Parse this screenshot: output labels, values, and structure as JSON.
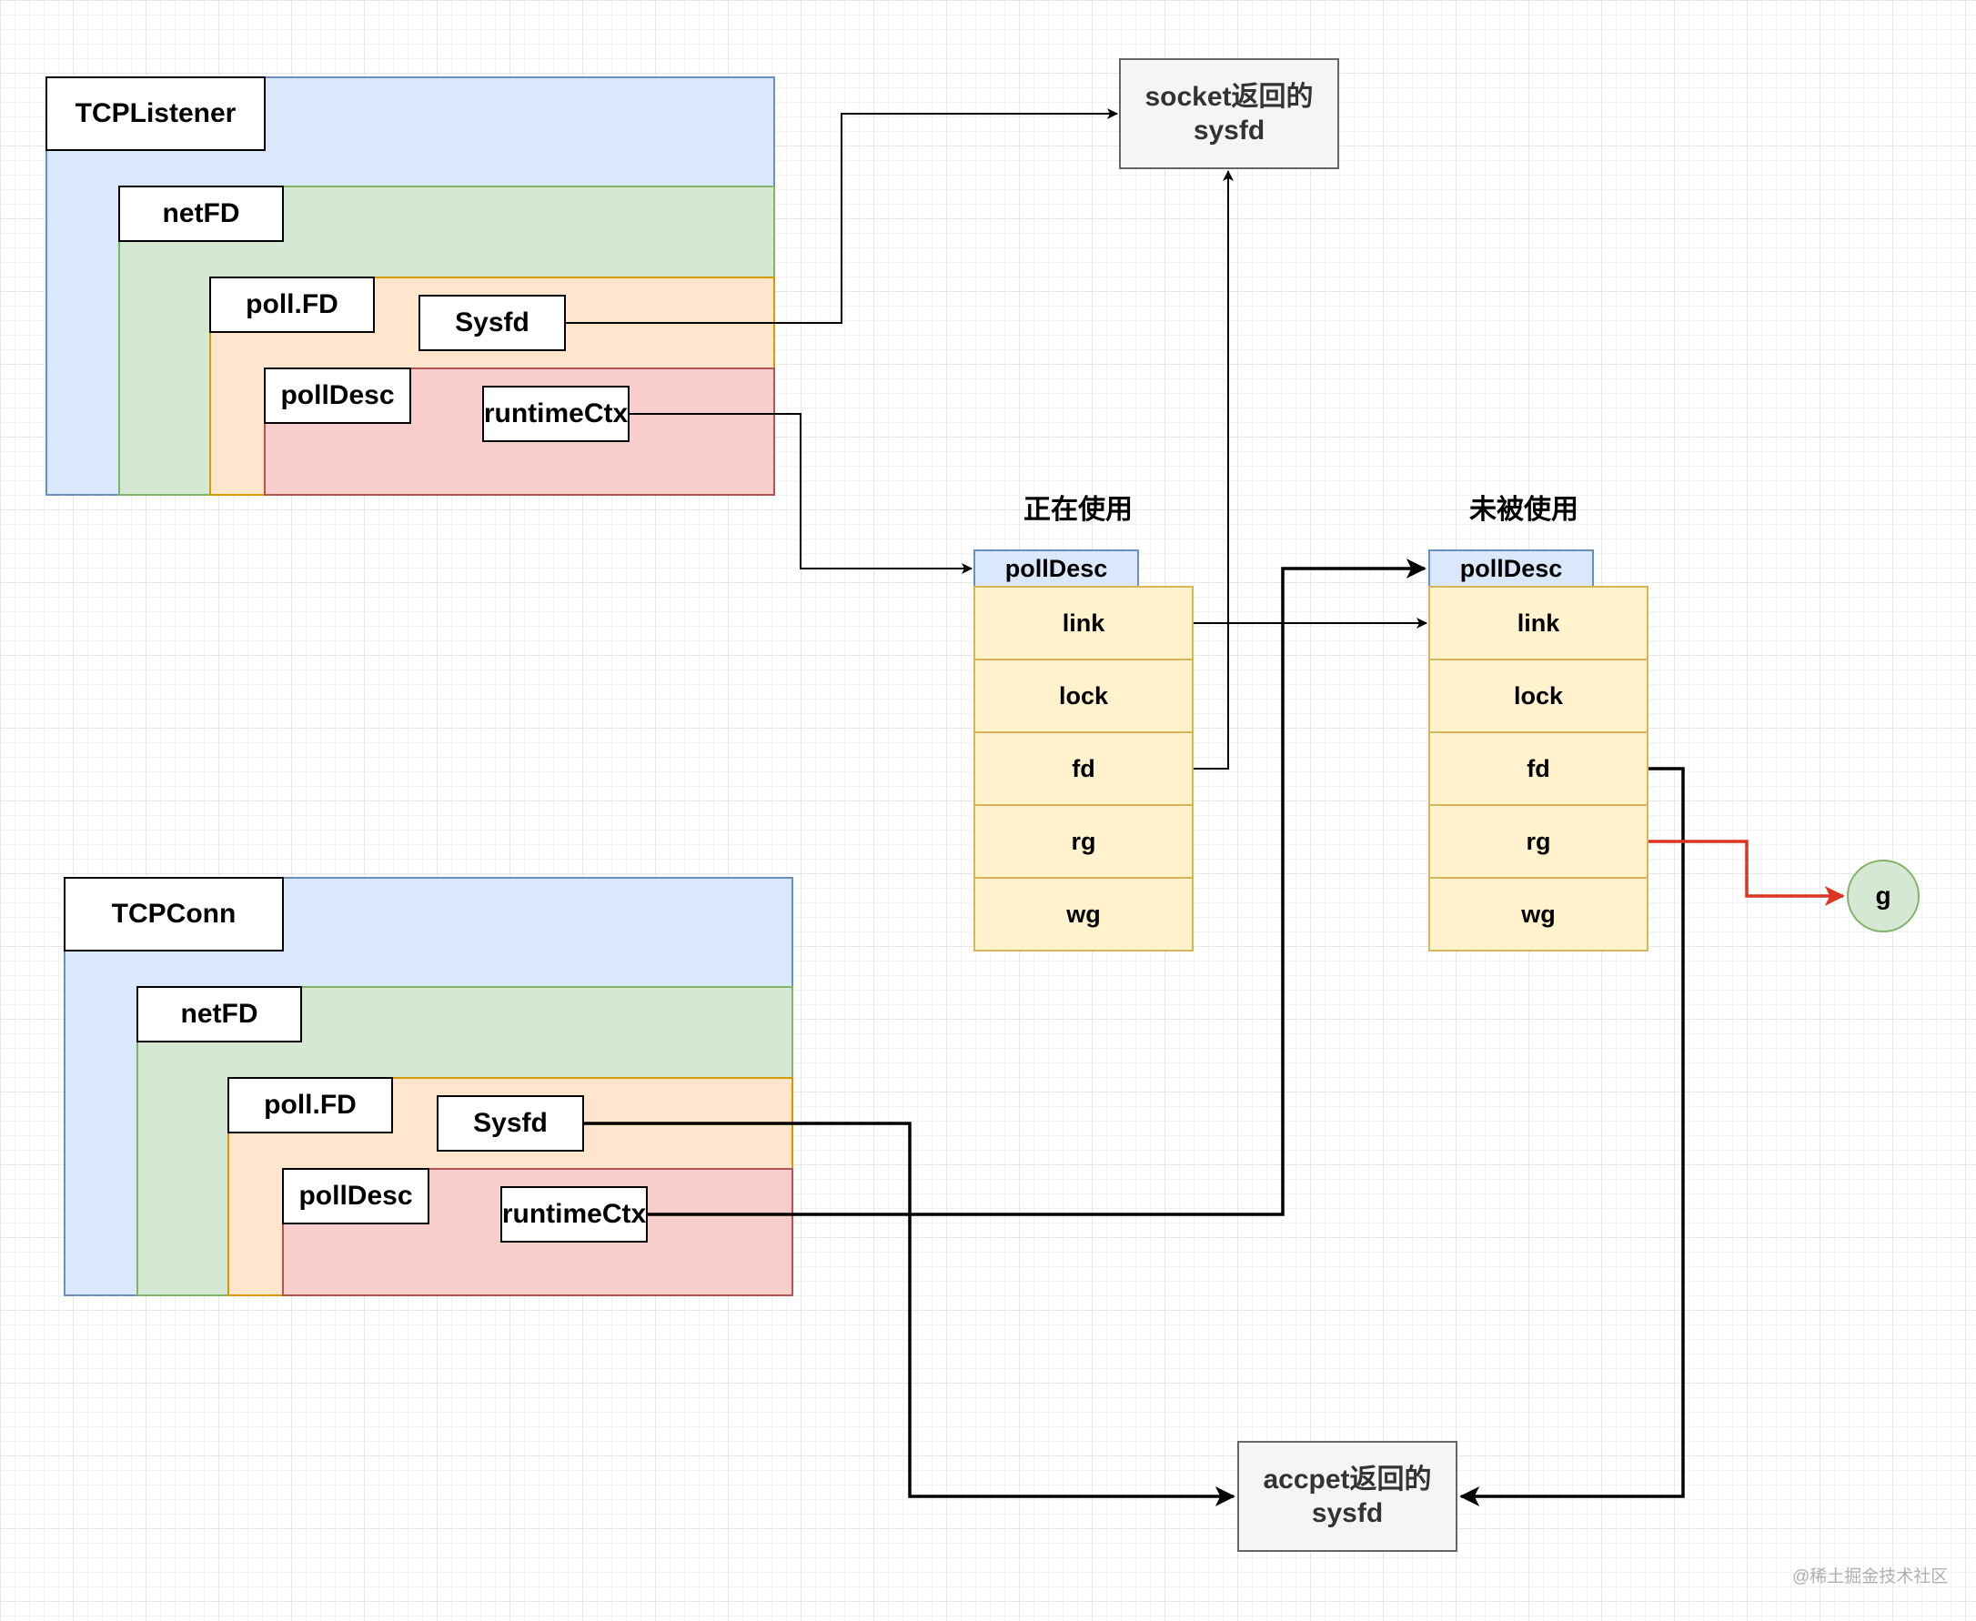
{
  "listener": {
    "title": "TCPListener",
    "netfd": "netFD",
    "pollfd": "poll.FD",
    "sysfd": "Sysfd",
    "polldesc": "pollDesc",
    "runtimectx": "runtimeCtx"
  },
  "conn": {
    "title": "TCPConn",
    "netfd": "netFD",
    "pollfd": "poll.FD",
    "sysfd": "Sysfd",
    "polldesc": "pollDesc",
    "runtimectx": "runtimeCtx"
  },
  "socket_sysfd": {
    "line1": "socket返回的",
    "line2": "sysfd"
  },
  "accept_sysfd": {
    "line1": "accpet返回的",
    "line2": "sysfd"
  },
  "in_use": {
    "title": "正在使用",
    "header": "pollDesc",
    "fields": [
      "link",
      "lock",
      "fd",
      "rg",
      "wg"
    ]
  },
  "unused": {
    "title": "未被使用",
    "header": "pollDesc",
    "fields": [
      "link",
      "lock",
      "fd",
      "rg",
      "wg"
    ]
  },
  "goroutine": {
    "label": "g"
  },
  "watermark": "@稀土掘金技术社区",
  "colors": {
    "arrow": "#000000",
    "red_arrow": "#dc3520"
  }
}
